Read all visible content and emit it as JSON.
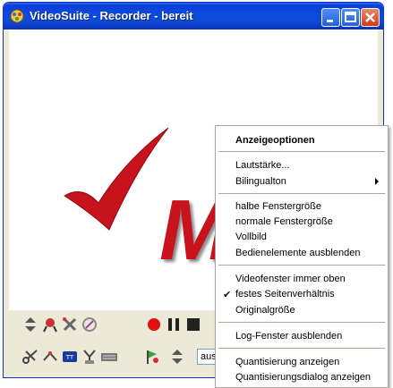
{
  "window": {
    "title": "VideoSuite - Recorder - bereit",
    "brand_color": "#c8121c",
    "icons": {
      "app": "videosuite-app-icon",
      "minimize": "minimize-icon",
      "maximize": "maximize-icon",
      "close": "close-icon"
    }
  },
  "video": {
    "logo_text": "Ma"
  },
  "toolbar": {
    "row1": [
      "spin-up-down-icon",
      "marker-icon",
      "tools-icon",
      "settings-icon",
      "record-icon",
      "pause-icon",
      "stop-icon"
    ],
    "row2": [
      "cut-icon",
      "clip-icon",
      "tv-icon",
      "antenna-icon",
      "keyboard-icon",
      "flag-icon",
      "spin-up-down-icon"
    ],
    "aus_value": "aus"
  },
  "context_menu": {
    "header": "Anzeigeoptionen",
    "group_audio": [
      "Lautstärke...",
      "Bilingualton"
    ],
    "group_size": [
      "halbe Fenstergröße",
      "normale Fenstergröße",
      "Vollbild",
      "Bedienelemente ausblenden"
    ],
    "group_view": [
      "Videofenster immer oben",
      "festes Seitenverhältnis",
      "Originalgröße"
    ],
    "group_log": [
      "Log-Fenster ausblenden"
    ],
    "group_quant": [
      "Quantisierung anzeigen",
      "Quantisierungsdialog anzeigen"
    ],
    "checked_item": "festes Seitenverhältnis"
  }
}
